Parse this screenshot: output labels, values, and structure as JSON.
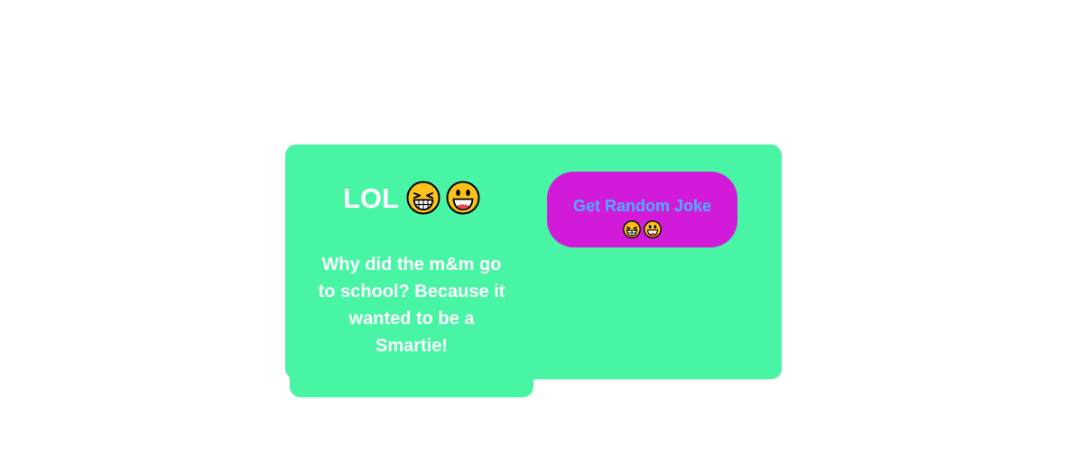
{
  "card": {
    "title": "LOL",
    "title_icons": [
      "grinning-squinting-face-icon",
      "smiling-face-icon"
    ],
    "joke": "Why did the m&m go to school? Because it wanted to be a Smartie!"
  },
  "button": {
    "label": "Get Random Joke",
    "icons": [
      "grinning-squinting-face-icon",
      "smiling-face-icon"
    ]
  },
  "colors": {
    "card_background": "#48f5a4",
    "button_background": "#d21bd8",
    "button_text": "#48b0ff",
    "text": "#ffffff"
  }
}
